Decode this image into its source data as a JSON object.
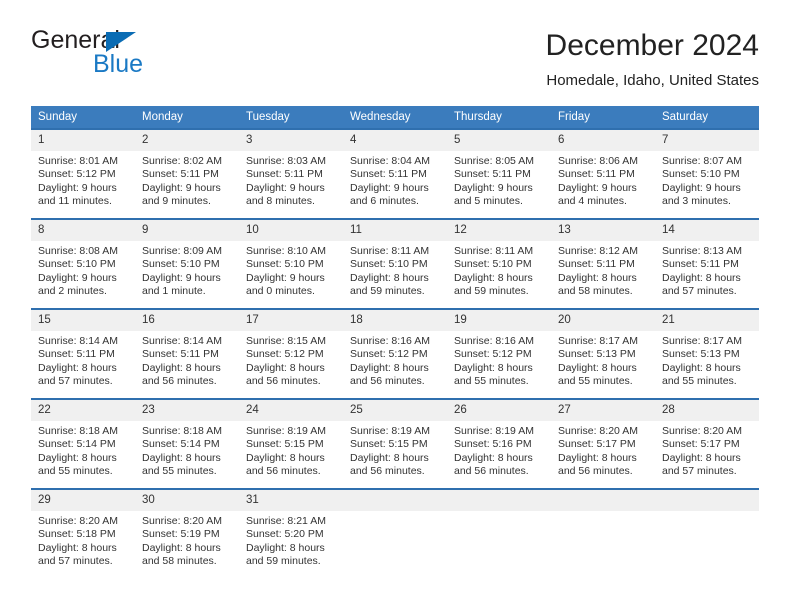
{
  "brand": {
    "name_top": "General",
    "name_bottom": "Blue",
    "triangle_color": "#0a6cb4",
    "blue_text_color": "#1a79c4"
  },
  "header": {
    "title": "December 2024",
    "subtitle": "Homedale, Idaho, United States"
  },
  "theme": {
    "header_bg": "#3b7cbd",
    "header_text": "#ffffff",
    "row_divider": "#2f6fae",
    "daynum_bg": "#f0f0f0",
    "body_text": "#333333"
  },
  "weekday_headers": [
    "Sunday",
    "Monday",
    "Tuesday",
    "Wednesday",
    "Thursday",
    "Friday",
    "Saturday"
  ],
  "labels": {
    "sunrise_prefix": "Sunrise:",
    "sunset_prefix": "Sunset:",
    "daylight_prefix": "Daylight:"
  },
  "weeks": [
    [
      {
        "day": "1",
        "sunrise": "Sunrise: 8:01 AM",
        "sunset": "Sunset: 5:12 PM",
        "daylight1": "Daylight: 9 hours",
        "daylight2": "and 11 minutes."
      },
      {
        "day": "2",
        "sunrise": "Sunrise: 8:02 AM",
        "sunset": "Sunset: 5:11 PM",
        "daylight1": "Daylight: 9 hours",
        "daylight2": "and 9 minutes."
      },
      {
        "day": "3",
        "sunrise": "Sunrise: 8:03 AM",
        "sunset": "Sunset: 5:11 PM",
        "daylight1": "Daylight: 9 hours",
        "daylight2": "and 8 minutes."
      },
      {
        "day": "4",
        "sunrise": "Sunrise: 8:04 AM",
        "sunset": "Sunset: 5:11 PM",
        "daylight1": "Daylight: 9 hours",
        "daylight2": "and 6 minutes."
      },
      {
        "day": "5",
        "sunrise": "Sunrise: 8:05 AM",
        "sunset": "Sunset: 5:11 PM",
        "daylight1": "Daylight: 9 hours",
        "daylight2": "and 5 minutes."
      },
      {
        "day": "6",
        "sunrise": "Sunrise: 8:06 AM",
        "sunset": "Sunset: 5:11 PM",
        "daylight1": "Daylight: 9 hours",
        "daylight2": "and 4 minutes."
      },
      {
        "day": "7",
        "sunrise": "Sunrise: 8:07 AM",
        "sunset": "Sunset: 5:10 PM",
        "daylight1": "Daylight: 9 hours",
        "daylight2": "and 3 minutes."
      }
    ],
    [
      {
        "day": "8",
        "sunrise": "Sunrise: 8:08 AM",
        "sunset": "Sunset: 5:10 PM",
        "daylight1": "Daylight: 9 hours",
        "daylight2": "and 2 minutes."
      },
      {
        "day": "9",
        "sunrise": "Sunrise: 8:09 AM",
        "sunset": "Sunset: 5:10 PM",
        "daylight1": "Daylight: 9 hours",
        "daylight2": "and 1 minute."
      },
      {
        "day": "10",
        "sunrise": "Sunrise: 8:10 AM",
        "sunset": "Sunset: 5:10 PM",
        "daylight1": "Daylight: 9 hours",
        "daylight2": "and 0 minutes."
      },
      {
        "day": "11",
        "sunrise": "Sunrise: 8:11 AM",
        "sunset": "Sunset: 5:10 PM",
        "daylight1": "Daylight: 8 hours",
        "daylight2": "and 59 minutes."
      },
      {
        "day": "12",
        "sunrise": "Sunrise: 8:11 AM",
        "sunset": "Sunset: 5:10 PM",
        "daylight1": "Daylight: 8 hours",
        "daylight2": "and 59 minutes."
      },
      {
        "day": "13",
        "sunrise": "Sunrise: 8:12 AM",
        "sunset": "Sunset: 5:11 PM",
        "daylight1": "Daylight: 8 hours",
        "daylight2": "and 58 minutes."
      },
      {
        "day": "14",
        "sunrise": "Sunrise: 8:13 AM",
        "sunset": "Sunset: 5:11 PM",
        "daylight1": "Daylight: 8 hours",
        "daylight2": "and 57 minutes."
      }
    ],
    [
      {
        "day": "15",
        "sunrise": "Sunrise: 8:14 AM",
        "sunset": "Sunset: 5:11 PM",
        "daylight1": "Daylight: 8 hours",
        "daylight2": "and 57 minutes."
      },
      {
        "day": "16",
        "sunrise": "Sunrise: 8:14 AM",
        "sunset": "Sunset: 5:11 PM",
        "daylight1": "Daylight: 8 hours",
        "daylight2": "and 56 minutes."
      },
      {
        "day": "17",
        "sunrise": "Sunrise: 8:15 AM",
        "sunset": "Sunset: 5:12 PM",
        "daylight1": "Daylight: 8 hours",
        "daylight2": "and 56 minutes."
      },
      {
        "day": "18",
        "sunrise": "Sunrise: 8:16 AM",
        "sunset": "Sunset: 5:12 PM",
        "daylight1": "Daylight: 8 hours",
        "daylight2": "and 56 minutes."
      },
      {
        "day": "19",
        "sunrise": "Sunrise: 8:16 AM",
        "sunset": "Sunset: 5:12 PM",
        "daylight1": "Daylight: 8 hours",
        "daylight2": "and 55 minutes."
      },
      {
        "day": "20",
        "sunrise": "Sunrise: 8:17 AM",
        "sunset": "Sunset: 5:13 PM",
        "daylight1": "Daylight: 8 hours",
        "daylight2": "and 55 minutes."
      },
      {
        "day": "21",
        "sunrise": "Sunrise: 8:17 AM",
        "sunset": "Sunset: 5:13 PM",
        "daylight1": "Daylight: 8 hours",
        "daylight2": "and 55 minutes."
      }
    ],
    [
      {
        "day": "22",
        "sunrise": "Sunrise: 8:18 AM",
        "sunset": "Sunset: 5:14 PM",
        "daylight1": "Daylight: 8 hours",
        "daylight2": "and 55 minutes."
      },
      {
        "day": "23",
        "sunrise": "Sunrise: 8:18 AM",
        "sunset": "Sunset: 5:14 PM",
        "daylight1": "Daylight: 8 hours",
        "daylight2": "and 55 minutes."
      },
      {
        "day": "24",
        "sunrise": "Sunrise: 8:19 AM",
        "sunset": "Sunset: 5:15 PM",
        "daylight1": "Daylight: 8 hours",
        "daylight2": "and 56 minutes."
      },
      {
        "day": "25",
        "sunrise": "Sunrise: 8:19 AM",
        "sunset": "Sunset: 5:15 PM",
        "daylight1": "Daylight: 8 hours",
        "daylight2": "and 56 minutes."
      },
      {
        "day": "26",
        "sunrise": "Sunrise: 8:19 AM",
        "sunset": "Sunset: 5:16 PM",
        "daylight1": "Daylight: 8 hours",
        "daylight2": "and 56 minutes."
      },
      {
        "day": "27",
        "sunrise": "Sunrise: 8:20 AM",
        "sunset": "Sunset: 5:17 PM",
        "daylight1": "Daylight: 8 hours",
        "daylight2": "and 56 minutes."
      },
      {
        "day": "28",
        "sunrise": "Sunrise: 8:20 AM",
        "sunset": "Sunset: 5:17 PM",
        "daylight1": "Daylight: 8 hours",
        "daylight2": "and 57 minutes."
      }
    ],
    [
      {
        "day": "29",
        "sunrise": "Sunrise: 8:20 AM",
        "sunset": "Sunset: 5:18 PM",
        "daylight1": "Daylight: 8 hours",
        "daylight2": "and 57 minutes."
      },
      {
        "day": "30",
        "sunrise": "Sunrise: 8:20 AM",
        "sunset": "Sunset: 5:19 PM",
        "daylight1": "Daylight: 8 hours",
        "daylight2": "and 58 minutes."
      },
      {
        "day": "31",
        "sunrise": "Sunrise: 8:21 AM",
        "sunset": "Sunset: 5:20 PM",
        "daylight1": "Daylight: 8 hours",
        "daylight2": "and 59 minutes."
      },
      {
        "day": "",
        "sunrise": "",
        "sunset": "",
        "daylight1": "",
        "daylight2": ""
      },
      {
        "day": "",
        "sunrise": "",
        "sunset": "",
        "daylight1": "",
        "daylight2": ""
      },
      {
        "day": "",
        "sunrise": "",
        "sunset": "",
        "daylight1": "",
        "daylight2": ""
      },
      {
        "day": "",
        "sunrise": "",
        "sunset": "",
        "daylight1": "",
        "daylight2": ""
      }
    ]
  ]
}
